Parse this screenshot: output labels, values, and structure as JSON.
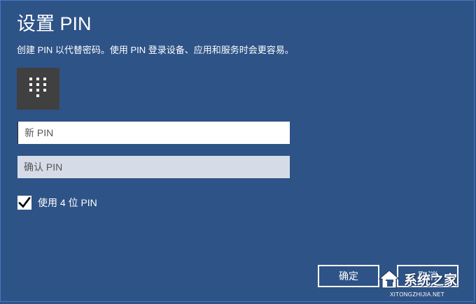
{
  "dialog": {
    "title": "设置 PIN",
    "subtitle": "创建 PIN 以代替密码。使用 PIN 登录设备、应用和服务时会更容易。",
    "keypad_icon": "keypad-icon",
    "new_pin_placeholder": "新 PIN",
    "confirm_pin_placeholder": "确认 PIN",
    "use_4_digit": {
      "label": "使用 4 位 PIN",
      "checked": true
    },
    "buttons": {
      "ok_label": "确定",
      "cancel_label": "取消"
    }
  },
  "watermark": {
    "name": "系统之家",
    "url": "XITONGZHIJIA.NET"
  },
  "colors": {
    "background": "#2e5387",
    "tile": "#404040",
    "confirm_field": "#d6dce7"
  }
}
